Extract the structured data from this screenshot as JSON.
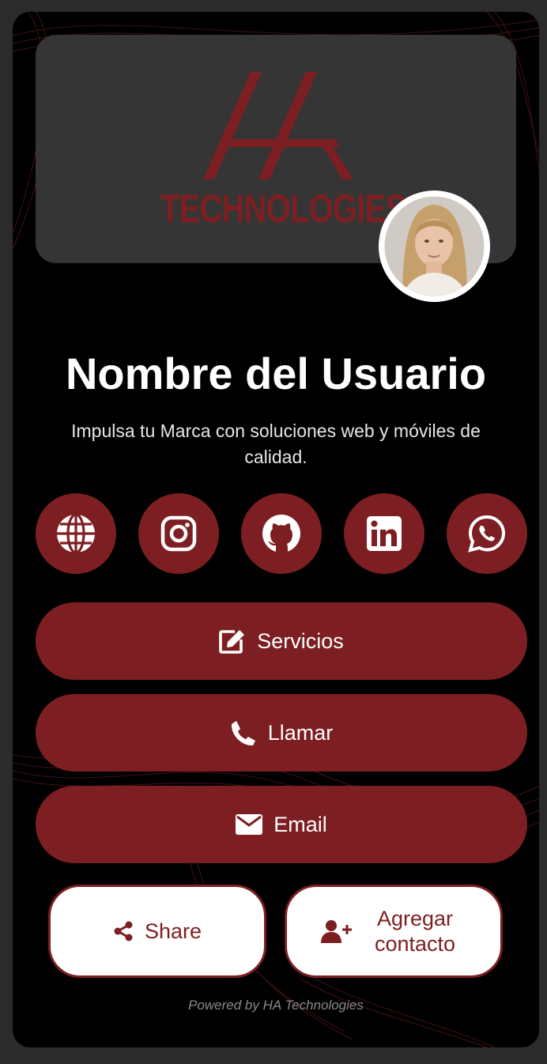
{
  "brand": {
    "logo_text": "TECHNOLOGIES",
    "logo_color": "#7d1f22"
  },
  "profile": {
    "name": "Nombre del Usuario",
    "tagline": "Impulsa tu Marca con soluciones web y móviles de calidad.",
    "avatar_icon": "profile-photo"
  },
  "socials": [
    {
      "icon": "globe-icon",
      "label": "Website"
    },
    {
      "icon": "instagram-icon",
      "label": "Instagram"
    },
    {
      "icon": "github-icon",
      "label": "GitHub"
    },
    {
      "icon": "linkedin-icon",
      "label": "LinkedIn"
    },
    {
      "icon": "whatsapp-icon",
      "label": "WhatsApp"
    }
  ],
  "actions": {
    "services_label": "Servicios",
    "call_label": "Llamar",
    "email_label": "Email"
  },
  "secondary": {
    "share_label": "Share",
    "add_contact_label": "Agregar contacto"
  },
  "footer": {
    "text": "Powered by HA Technologies"
  },
  "colors": {
    "accent": "#7d1f22",
    "background": "#000000",
    "page": "#2b2b2b",
    "banner": "#353535"
  }
}
